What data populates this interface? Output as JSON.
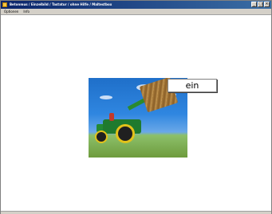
{
  "window": {
    "title": "Betonmus / Einzelbild / Tastatur / ohne Hilfe / Maltestbox",
    "minimize_label": "_",
    "maximize_label": "□",
    "close_label": "×"
  },
  "menu": {
    "items": [
      {
        "label": "Optionen"
      },
      {
        "label": "Info"
      }
    ]
  },
  "main": {
    "image_icon_name": "tractor-hay-bale-photo",
    "word": "ein"
  },
  "colors": {
    "titlebar": "#0a246a",
    "menubar": "#d4d0c8",
    "background": "#ffffff"
  }
}
